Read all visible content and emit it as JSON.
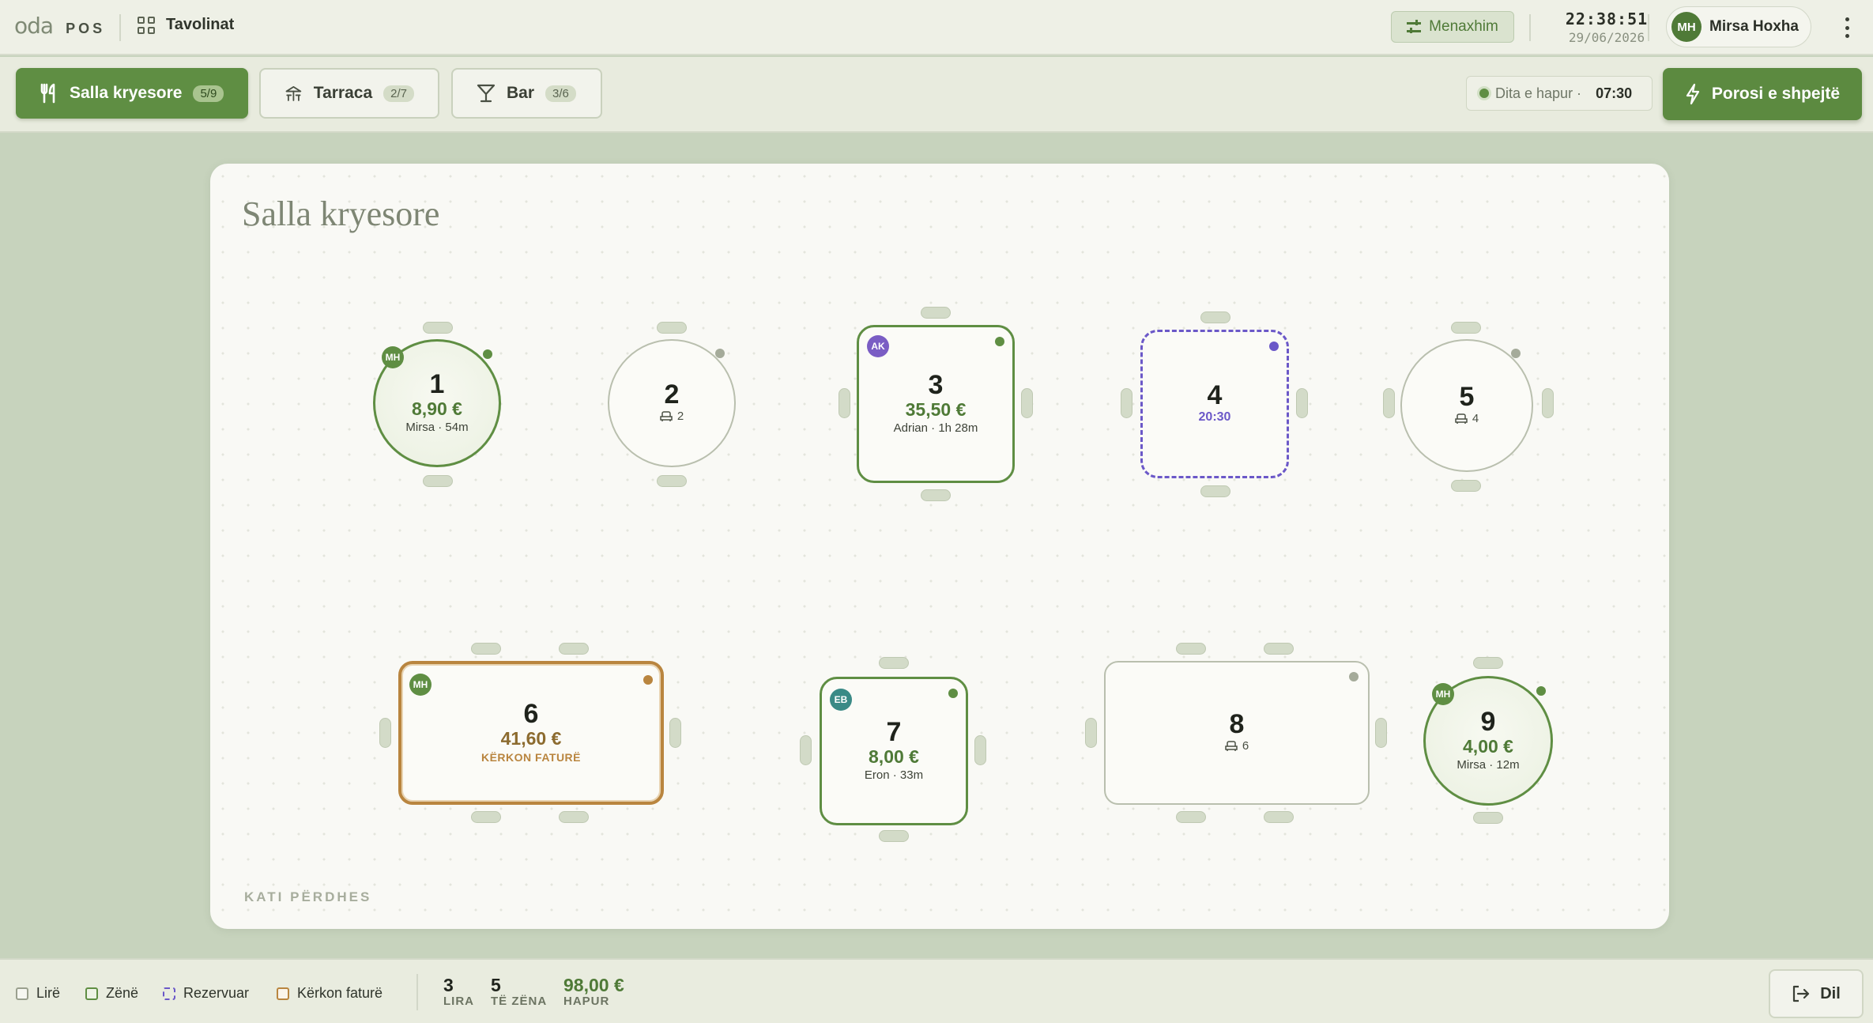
{
  "header": {
    "logo_mark": "oda",
    "logo_text": "POS",
    "section_title": "Tavolinat",
    "manage_label": "Menaxhim",
    "time": "22:38:51",
    "date": "29/06/2026",
    "user": {
      "initials": "MH",
      "name": "Mirsa Hoxha"
    }
  },
  "rooms": [
    {
      "label": "Salla kryesore",
      "count": "5/9",
      "active": true
    },
    {
      "label": "Tarraca",
      "count": "2/7",
      "active": false
    },
    {
      "label": "Bar",
      "count": "3/6",
      "active": false
    }
  ],
  "day_status": {
    "label": "Dita e hapur ·",
    "time": "07:30"
  },
  "quick_order_label": "Porosi e shpejtë",
  "floor": {
    "title": "Salla kryesore",
    "footer": "KATI PËRDHES"
  },
  "tables": [
    {
      "number": "1",
      "status": "occupied",
      "amount": "8,90 €",
      "detail": "Mirsa · 54m",
      "waiter": "MH"
    },
    {
      "number": "2",
      "status": "free",
      "seats": "2"
    },
    {
      "number": "3",
      "status": "occupied",
      "amount": "35,50 €",
      "detail": "Adrian · 1h 28m",
      "waiter": "AK"
    },
    {
      "number": "4",
      "status": "reserved",
      "reservation_time": "20:30"
    },
    {
      "number": "5",
      "status": "free",
      "seats": "4"
    },
    {
      "number": "6",
      "status": "bill_requested",
      "amount": "41,60 €",
      "detail": "KËRKON FATURË",
      "waiter": "MH"
    },
    {
      "number": "7",
      "status": "occupied",
      "amount": "8,00 €",
      "detail": "Eron · 33m",
      "waiter": "EB"
    },
    {
      "number": "8",
      "status": "free",
      "seats": "6"
    },
    {
      "number": "9",
      "status": "occupied",
      "amount": "4,00 €",
      "detail": "Mirsa · 12m",
      "waiter": "MH"
    }
  ],
  "legend": [
    {
      "label": "Lirë",
      "color": "#9aa08e"
    },
    {
      "label": "Zënë",
      "color": "#5f8e43"
    },
    {
      "label": "Rezervuar",
      "color": "#6b58c8"
    },
    {
      "label": "Kërkon faturë",
      "color": "#b9853f"
    }
  ],
  "stats": [
    {
      "value": "3",
      "label": "LIRA"
    },
    {
      "value": "5",
      "label": "TË ZËNA"
    },
    {
      "value": "98,00 €",
      "label": "HAPUR"
    }
  ],
  "exit_label": "Dil",
  "colors": {
    "accent": "#5f8e43",
    "reserved": "#6b58c8",
    "bill": "#b9853f",
    "free": "#b9bfae"
  }
}
